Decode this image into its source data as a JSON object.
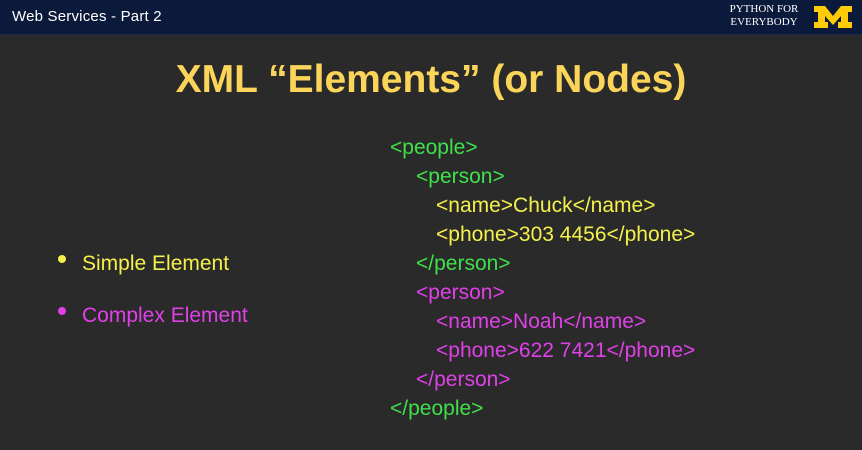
{
  "header": {
    "title": "Web Services - Part 2",
    "brand_line1": "PYTHON FOR",
    "brand_line2": "EVERYBODY",
    "logo_letter": "M",
    "colors": {
      "bar": "#0b1a3a",
      "logo": "#ffcb05"
    }
  },
  "slide": {
    "heading": "XML “Elements” (or Nodes)",
    "bullets": [
      {
        "label": "Simple Element",
        "color": "#f5f04a"
      },
      {
        "label": "Complex Element",
        "color": "#e040e8"
      }
    ],
    "code": [
      {
        "text": "<people>",
        "color": "#3fe04a"
      },
      {
        "text": "<person>",
        "color": "#3fe04a"
      },
      {
        "text": "<name>Chuck</name>",
        "color": "#f5f04a"
      },
      {
        "text": "<phone>303 4456</phone>",
        "color": "#f5f04a"
      },
      {
        "text": "</person>",
        "color": "#3fe04a"
      },
      {
        "text": "<person>",
        "color": "#e040e8"
      },
      {
        "text": "<name>Noah</name>",
        "color": "#e040e8"
      },
      {
        "text": "<phone>622 7421</phone>",
        "color": "#e040e8"
      },
      {
        "text": "</person>",
        "color": "#e040e8"
      },
      {
        "text": "</people>",
        "color": "#3fe04a"
      }
    ]
  }
}
